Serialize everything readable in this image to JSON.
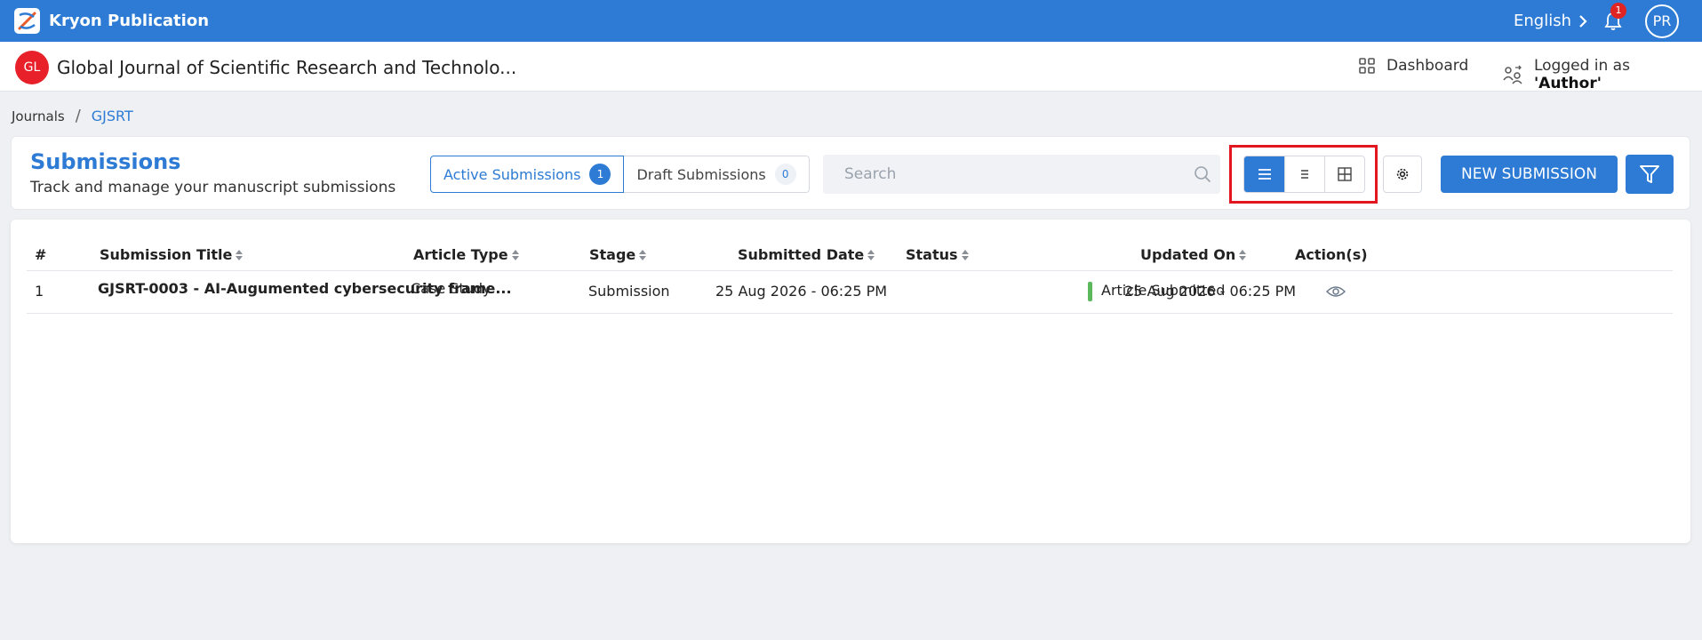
{
  "app": {
    "name": "Kryon Publication",
    "language": "English",
    "notification_count": "1",
    "user_initials": "PR"
  },
  "journal": {
    "logo_initials": "GL",
    "name": "Global Journal of Scientific Research and Technolo...",
    "dashboard_label": "Dashboard",
    "logged_in_prefix": "Logged in as ",
    "logged_in_role": "'Author'"
  },
  "breadcrumb": {
    "root": "Journals",
    "separator": "/",
    "current": "GJSRT"
  },
  "header": {
    "title": "Submissions",
    "subtitle": "Track and manage your manuscript submissions",
    "tabs": [
      {
        "label": "Active Submissions",
        "count": "1"
      },
      {
        "label": "Draft Submissions",
        "count": "0"
      }
    ],
    "search_placeholder": "Search",
    "new_submission_label": "NEW SUBMISSION"
  },
  "table": {
    "columns": [
      "#",
      "Submission Title",
      "Article Type",
      "Stage",
      "Submitted Date",
      "Status",
      "Updated On",
      "Action(s)"
    ],
    "rows": [
      {
        "index": "1",
        "title": "GJSRT-0003 - AI-Augumented cybersecurity frame...",
        "article_type": "Case Study",
        "stage": "Submission",
        "submitted_date": "25 Aug 2026 - 06:25 PM",
        "status": "Article Submitted",
        "updated_on": "25 Aug 2026 - 06:25 PM"
      }
    ]
  },
  "colors": {
    "primary": "#2d7bd4",
    "highlight": "#e3151e",
    "status_submitted": "#5cb85c",
    "journal_logo": "#e8202a"
  },
  "icons": {
    "view_modes": [
      "list-view-icon",
      "compact-list-icon",
      "grid-view-icon"
    ],
    "settings": "gear-icon",
    "filter": "filter-icon",
    "action": "eye-icon"
  }
}
